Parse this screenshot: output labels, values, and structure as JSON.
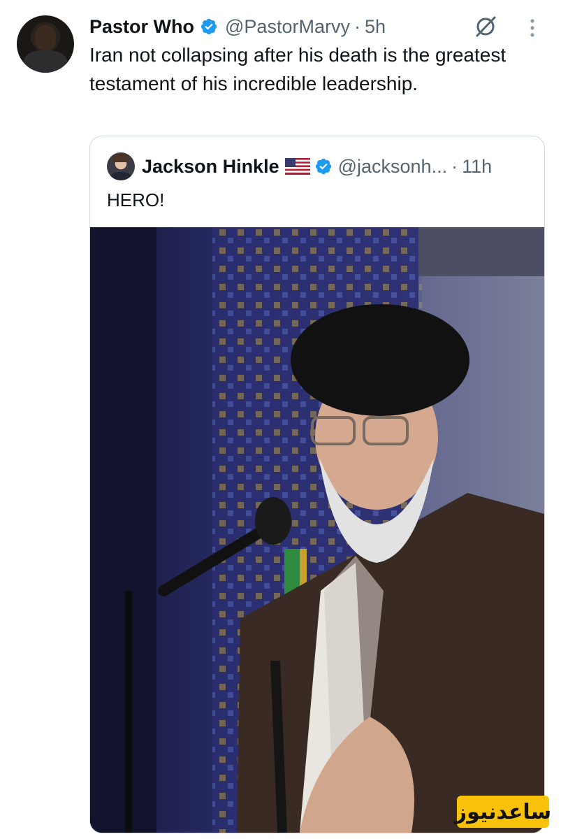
{
  "tweet": {
    "author_name": "Pastor Who",
    "author_handle": "@PastorMarvy",
    "separator": "·",
    "time": "5h",
    "text": "Iran not collapsing after his death is the greatest testament of his incredible leadership."
  },
  "quoted_tweet": {
    "author_name": "Jackson Hinkle",
    "flag_icon": "us-flag-icon",
    "author_handle": "@jacksonh...",
    "separator": "·",
    "time": "11h",
    "text": "HERO!"
  },
  "watermark": {
    "text": "ساعدنیوز"
  },
  "icons": {
    "verified": "verified-badge-icon",
    "grok": "grok-icon",
    "more": "more-options-icon"
  },
  "colors": {
    "verified_blue": "#1d9bf0",
    "secondary_text": "#536471",
    "primary_text": "#0f1419",
    "watermark_bg": "#f8c20a",
    "border": "#cfd9de"
  }
}
